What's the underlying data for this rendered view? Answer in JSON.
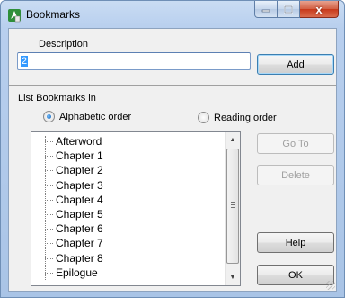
{
  "window": {
    "title": "Bookmarks",
    "minimize_glyph": "",
    "maximize_glyph": "",
    "close_glyph": "x"
  },
  "description": {
    "label": "Description",
    "value": "2",
    "placeholder": ""
  },
  "buttons": {
    "add": "Add",
    "goto": "Go To",
    "delete": "Delete",
    "help": "Help",
    "ok": "OK"
  },
  "order": {
    "label": "List Bookmarks in",
    "alphabetic": "Alphabetic order",
    "reading": "Reading order",
    "selected": "alphabetic"
  },
  "bookmarks": [
    "Afterword",
    "Chapter 1",
    "Chapter 2",
    "Chapter 3",
    "Chapter 4",
    "Chapter 5",
    "Chapter 6",
    "Chapter 7",
    "Chapter 8",
    "Epilogue"
  ],
  "icons": {
    "app": "bookmark-app-icon",
    "scroll_up": "scroll-up-arrow-icon",
    "scroll_down": "scroll-down-arrow-icon"
  },
  "colors": {
    "selection": "#3399ff",
    "close_button": "#c7391a"
  }
}
